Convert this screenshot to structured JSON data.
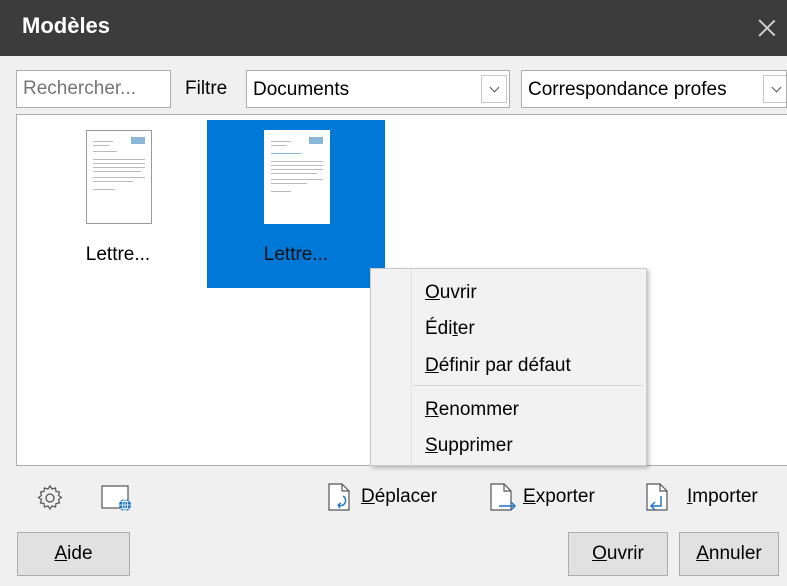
{
  "window": {
    "title": "Modèles",
    "close_icon": "close-icon"
  },
  "toolbar": {
    "search_placeholder": "Rechercher...",
    "filter_label": "Filtre",
    "filter_value": "Documents",
    "category_value": "Correspondance profes"
  },
  "templates": [
    {
      "label": "Lettre...",
      "selected": false
    },
    {
      "label": "Lettre...",
      "selected": true
    }
  ],
  "context_menu": {
    "items": [
      {
        "mnemonic_pre": "",
        "mnemonic": "O",
        "post": "uvrir"
      },
      {
        "mnemonic_pre": "Édi",
        "mnemonic": "t",
        "post": "er"
      },
      {
        "mnemonic_pre": "",
        "mnemonic": "D",
        "post": "éfinir par défaut"
      },
      {
        "mnemonic_pre": "",
        "mnemonic": "R",
        "post": "enommer"
      },
      {
        "mnemonic_pre": "",
        "mnemonic": "S",
        "post": "upprimer"
      }
    ]
  },
  "bottom_bar": {
    "settings_icon": "gear-icon",
    "online_icon": "web-document-icon",
    "move": {
      "mnemonic": "D",
      "post": "éplacer"
    },
    "export": {
      "mnemonic": "E",
      "post": "xporter"
    },
    "import": {
      "mnemonic": "I",
      "post": "mporter"
    }
  },
  "buttons": {
    "help": {
      "mnemonic": "A",
      "post": "ide"
    },
    "open": {
      "mnemonic": "O",
      "post": "uvrir"
    },
    "cancel": {
      "mnemonic": "A",
      "post": "nnuler"
    }
  },
  "colors": {
    "titlebar": "#3c3c3c",
    "selection": "#0078d7"
  }
}
